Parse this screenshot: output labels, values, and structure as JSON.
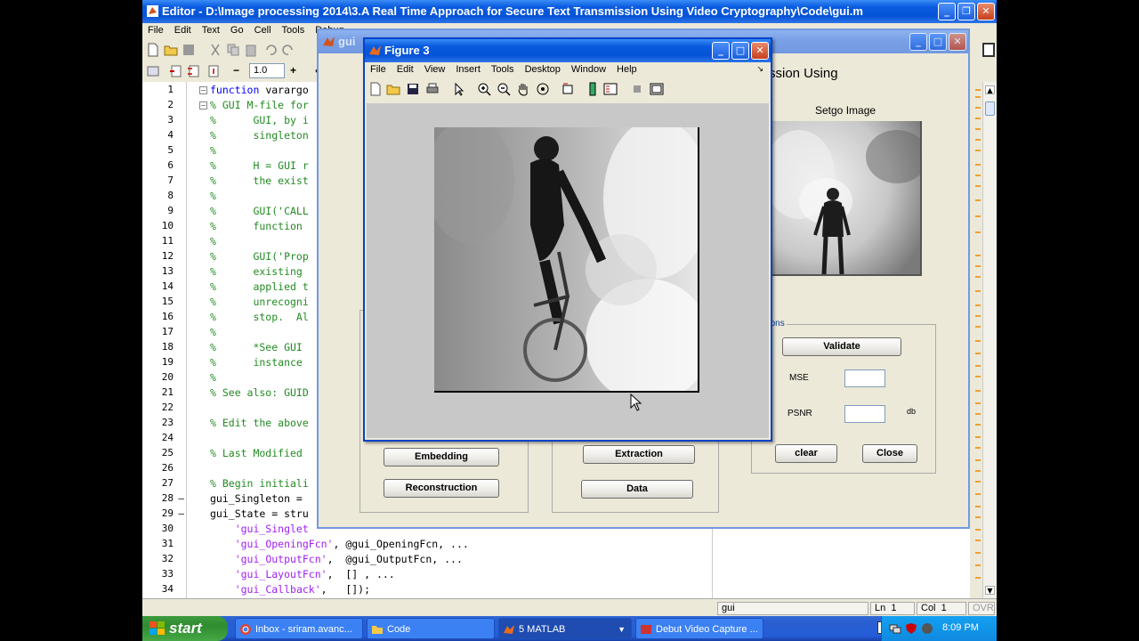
{
  "editor": {
    "title": "Editor - D:\\Image processing 2014\\3.A Real Time Approach for Secure Text Transmission Using Video Cryptography\\Code\\gui.m",
    "menu": [
      "File",
      "Edit",
      "Text",
      "Go",
      "Cell",
      "Tools",
      "Debug"
    ],
    "zoom_value": "1.0",
    "lines": [
      {
        "n": "1",
        "text": "function varargo",
        "cls": "kw"
      },
      {
        "n": "2",
        "text": "% GUI M-file for",
        "cls": "cm"
      },
      {
        "n": "3",
        "text": "%      GUI, by i",
        "cls": "cm"
      },
      {
        "n": "4",
        "text": "%      singleton",
        "cls": "cm"
      },
      {
        "n": "5",
        "text": "%",
        "cls": "cm"
      },
      {
        "n": "6",
        "text": "%      H = GUI r",
        "cls": "cm"
      },
      {
        "n": "7",
        "text": "%      the exist",
        "cls": "cm"
      },
      {
        "n": "8",
        "text": "%",
        "cls": "cm"
      },
      {
        "n": "9",
        "text": "%      GUI('CALL",
        "cls": "cm"
      },
      {
        "n": "10",
        "text": "%      function",
        "cls": "cm"
      },
      {
        "n": "11",
        "text": "%",
        "cls": "cm"
      },
      {
        "n": "12",
        "text": "%      GUI('Prop",
        "cls": "cm"
      },
      {
        "n": "13",
        "text": "%      existing",
        "cls": "cm"
      },
      {
        "n": "14",
        "text": "%      applied t",
        "cls": "cm"
      },
      {
        "n": "15",
        "text": "%      unrecogni",
        "cls": "cm"
      },
      {
        "n": "16",
        "text": "%      stop.  Al",
        "cls": "cm"
      },
      {
        "n": "17",
        "text": "%",
        "cls": "cm"
      },
      {
        "n": "18",
        "text": "%      *See GUI",
        "cls": "cm"
      },
      {
        "n": "19",
        "text": "%      instance",
        "cls": "cm"
      },
      {
        "n": "20",
        "text": "%",
        "cls": "cm"
      },
      {
        "n": "21",
        "text": "% See also: GUID",
        "cls": "cm"
      },
      {
        "n": "22",
        "text": "",
        "cls": ""
      },
      {
        "n": "23",
        "text": "% Edit the above",
        "cls": "cm"
      },
      {
        "n": "24",
        "text": "",
        "cls": ""
      },
      {
        "n": "25",
        "text": "% Last Modified",
        "cls": "cm"
      },
      {
        "n": "26",
        "text": "",
        "cls": ""
      },
      {
        "n": "27",
        "text": "% Begin initiali",
        "cls": "cm"
      },
      {
        "n": "28",
        "text": "gui_Singleton =",
        "cls": ""
      },
      {
        "n": "29",
        "text": "gui_State = stru",
        "cls": ""
      },
      {
        "n": "30",
        "text": "    'gui_Singlet",
        "cls": "st"
      },
      {
        "n": "31",
        "text": "    'gui_OpeningFcn', @gui_OpeningFcn, ...",
        "cls": "mix"
      },
      {
        "n": "32",
        "text": "    'gui_OutputFcn',  @gui_OutputFcn, ...",
        "cls": "mix"
      },
      {
        "n": "33",
        "text": "    'gui_LayoutFcn',  [] , ...",
        "cls": "mix"
      },
      {
        "n": "34",
        "text": "    'gui_Callback',   []);",
        "cls": "mix"
      }
    ],
    "status": {
      "file": "gui",
      "ln_label": "Ln",
      "ln": "1",
      "col_label": "Col",
      "col": "1",
      "ovr": "OVR"
    }
  },
  "gui_window": {
    "title": "gui",
    "heading": "ssion Using",
    "stego_label": "Setgo Image",
    "validations_label": "lidations",
    "validate_button": "Validate",
    "mse_label": "MSE",
    "psnr_label": "PSNR",
    "db_label": "db",
    "clear_button": "clear",
    "close_button": "Close",
    "embedding_button": "Embedding",
    "reconstruction_button": "Reconstruction",
    "extraction_button": "Extraction",
    "data_button": "Data"
  },
  "figure": {
    "title": "Figure 3",
    "menu": [
      "File",
      "Edit",
      "View",
      "Insert",
      "Tools",
      "Desktop",
      "Window",
      "Help"
    ]
  },
  "taskbar": {
    "start": "start",
    "tasks": [
      "Inbox - sriram.avanc...",
      "Code",
      "5 MATLAB",
      "Debut Video Capture ..."
    ],
    "time": "8:09 PM"
  }
}
